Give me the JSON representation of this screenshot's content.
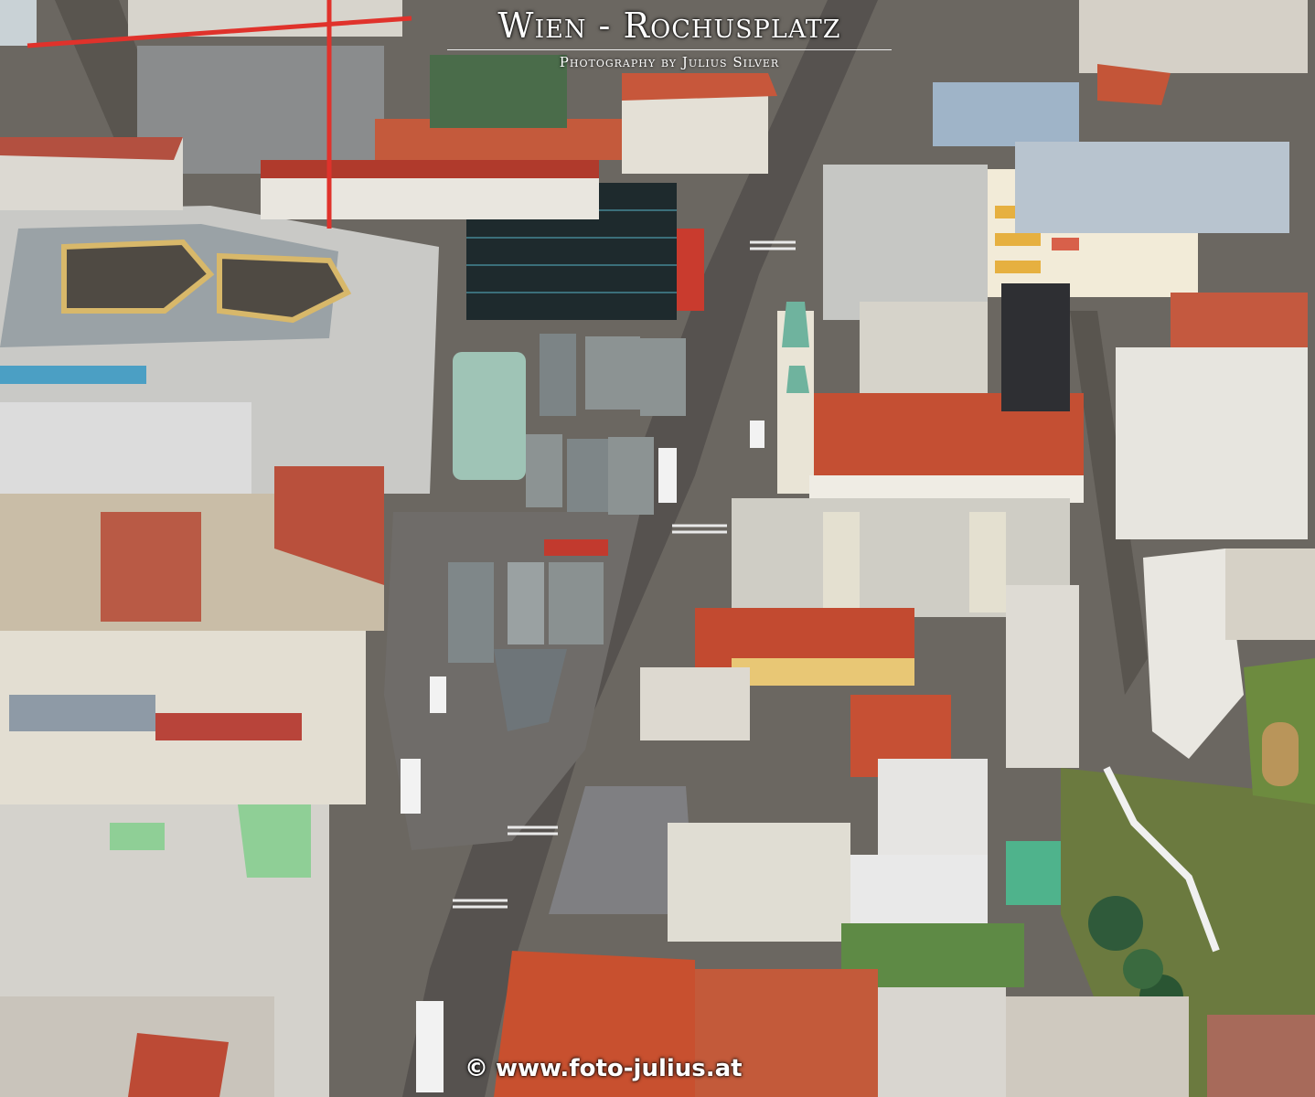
{
  "title": "Wien - Rochusplatz",
  "subtitle": "Photography by Julius Silver",
  "watermark": {
    "symbol": "©",
    "url": "www.foto-julius.at"
  }
}
